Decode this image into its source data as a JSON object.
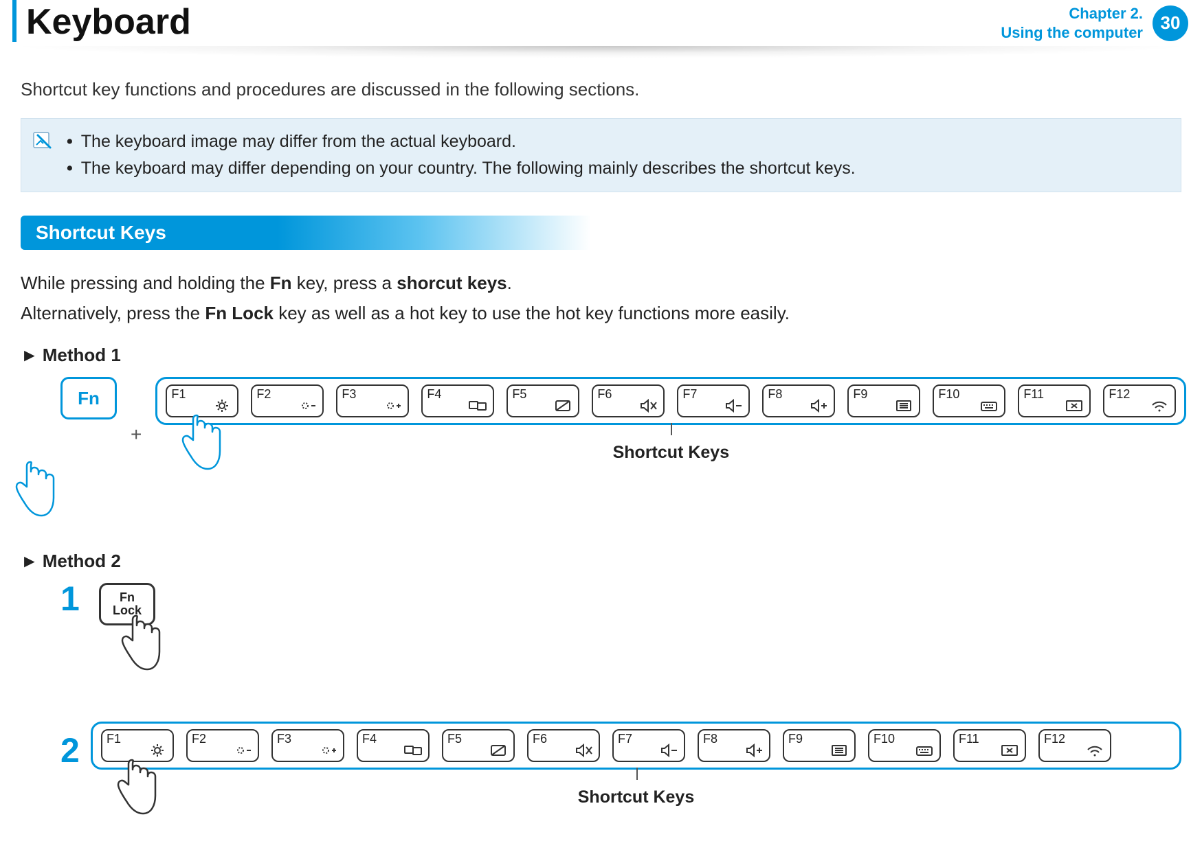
{
  "header": {
    "title": "Keyboard",
    "chapter_line1": "Chapter 2.",
    "chapter_line2": "Using the computer",
    "page_number": "30"
  },
  "intro": "Shortcut key functions and procedures are discussed in the following sections.",
  "note": {
    "items": [
      "The keyboard image may differ from the actual keyboard.",
      "The keyboard may differ depending on your country. The following mainly describes the shortcut keys."
    ]
  },
  "section_title": "Shortcut Keys",
  "para1_pre": "While pressing and holding the ",
  "para1_b1": "Fn",
  "para1_mid": " key, press a ",
  "para1_b2": "shorcut keys",
  "para1_post": ".",
  "para2_pre": "Alternatively, press the ",
  "para2_b1": "Fn Lock",
  "para2_post": " key as well as a hot key to use the hot key functions more easily.",
  "method1_label": "Method 1",
  "method2_label": "Method 2",
  "triangle": "►",
  "fn_label": "Fn",
  "plus": "+",
  "frow_caption": "Shortcut Keys",
  "step1": "1",
  "step2": "2",
  "fnlock_line1": "Fn",
  "fnlock_line2": "Lock",
  "fkeys": [
    {
      "label": "F1",
      "icon": "settings"
    },
    {
      "label": "F2",
      "icon": "bright-down"
    },
    {
      "label": "F3",
      "icon": "bright-up"
    },
    {
      "label": "F4",
      "icon": "display-switch"
    },
    {
      "label": "F5",
      "icon": "touchpad-off"
    },
    {
      "label": "F6",
      "icon": "mute"
    },
    {
      "label": "F7",
      "icon": "vol-down"
    },
    {
      "label": "F8",
      "icon": "vol-up"
    },
    {
      "label": "F9",
      "icon": "list"
    },
    {
      "label": "F10",
      "icon": "keyboard"
    },
    {
      "label": "F11",
      "icon": "screen-x"
    },
    {
      "label": "F12",
      "icon": "wifi"
    }
  ]
}
